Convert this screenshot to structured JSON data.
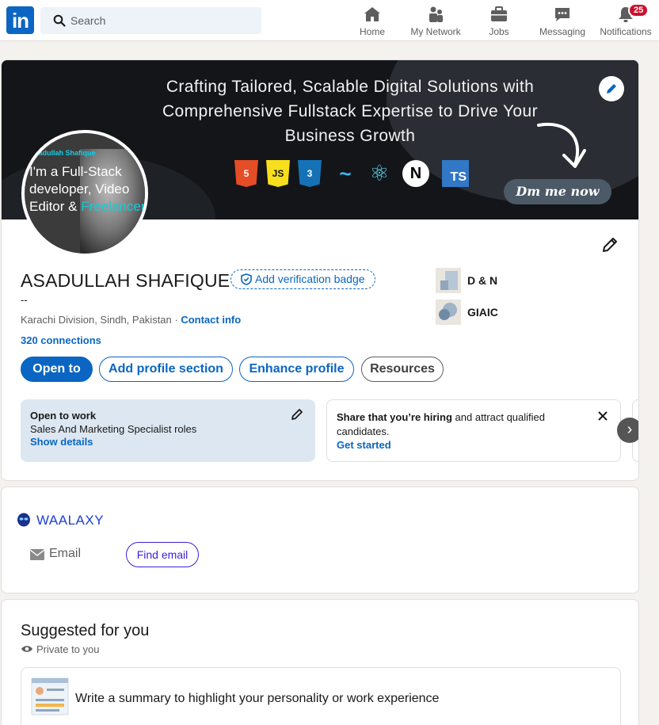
{
  "nav": {
    "logo": "in",
    "search_placeholder": "Search",
    "items": [
      {
        "label": "Home",
        "icon": "home-icon"
      },
      {
        "label": "My Network",
        "icon": "network-icon"
      },
      {
        "label": "Jobs",
        "icon": "briefcase-icon"
      },
      {
        "label": "Messaging",
        "icon": "messaging-icon"
      },
      {
        "label": "Notifications",
        "icon": "bell-icon",
        "badge": "25"
      }
    ]
  },
  "banner": {
    "headline": "Crafting Tailored, Scalable Digital Solutions with Comprehensive Fullstack Expertise to Drive Your Business Growth",
    "tech": [
      "5",
      "JS",
      "3",
      "~",
      "⚛",
      "N",
      "TS"
    ],
    "cta": "Dm me now"
  },
  "avatar": {
    "name_overlay": "Asadullah Shafique",
    "text_line": "I'm a Full-Stack developer, Video Editor &",
    "text_teal": "Freelancer"
  },
  "profile": {
    "name": "ASADULLAH SHAFIQUE",
    "verify_label": "Add verification badge",
    "headline": "--",
    "location": "Karachi Division, Sindh, Pakistan",
    "separator": " · ",
    "contact_label": "Contact info",
    "connections": "320 connections",
    "orgs": [
      {
        "name": "D & N"
      },
      {
        "name": "GIAIC"
      }
    ],
    "actions": {
      "open_to": "Open to",
      "add_section": "Add profile section",
      "enhance": "Enhance profile",
      "resources": "Resources"
    },
    "open_to_work": {
      "title": "Open to work",
      "roles": "Sales And Marketing Specialist roles",
      "link": "Show details"
    },
    "hiring": {
      "bold": "Share that you’re hiring",
      "rest": " and attract qualified candidates.",
      "link": "Get started"
    },
    "carousel_next": "›"
  },
  "waalaxy": {
    "title": "WAALAXY",
    "email_label": "Email",
    "find_email": "Find email"
  },
  "suggested": {
    "title": "Suggested for you",
    "privacy": "Private to you",
    "item": "Write a summary to highlight your personality or work experience"
  },
  "colors": {
    "brand": "#0a66c2",
    "badge": "#cb112d",
    "waalaxy": "#1d3fd6"
  }
}
